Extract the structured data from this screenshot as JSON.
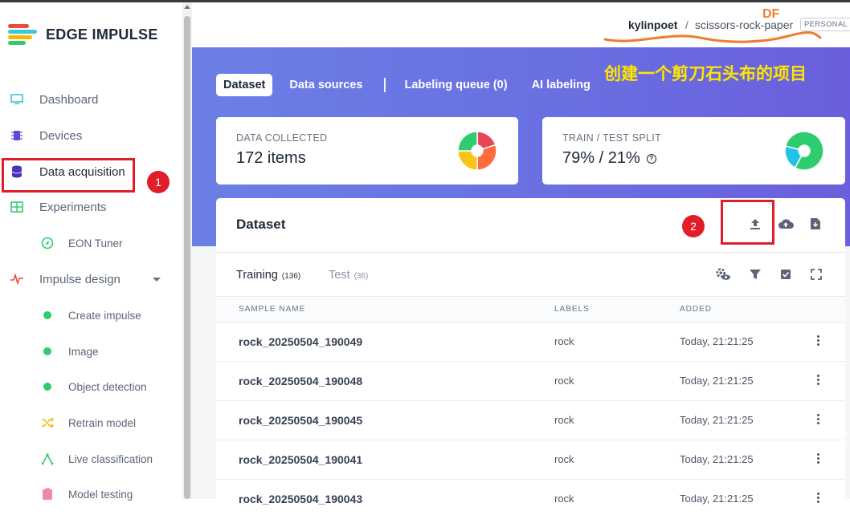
{
  "brand": {
    "name": "EDGE IMPULSE",
    "colors": [
      "#e84c3d",
      "#3ec8d6",
      "#f5b800",
      "#2ecc71"
    ]
  },
  "sidebar": {
    "items": [
      {
        "label": "Dashboard",
        "icon": "monitor-icon"
      },
      {
        "label": "Devices",
        "icon": "chip-icon"
      },
      {
        "label": "Data acquisition",
        "icon": "database-icon",
        "active": true
      },
      {
        "label": "Experiments",
        "icon": "table-icon"
      },
      {
        "label": "EON Tuner",
        "icon": "compass-icon"
      },
      {
        "label": "Impulse design",
        "icon": "pulse-icon"
      },
      {
        "label": "Create impulse",
        "icon": "dot-icon"
      },
      {
        "label": "Image",
        "icon": "dot-icon"
      },
      {
        "label": "Object detection",
        "icon": "dot-icon"
      },
      {
        "label": "Retrain model",
        "icon": "shuffle-icon"
      },
      {
        "label": "Live classification",
        "icon": "signal-icon"
      },
      {
        "label": "Model testing",
        "icon": "clipboard-icon"
      }
    ]
  },
  "annotations": {
    "step1": "1",
    "step2": "2",
    "df": "DF",
    "note": "创建一个剪刀石头布的项目"
  },
  "topbar": {
    "user": "kylinpoet",
    "separator": "/",
    "project": "scissors-rock-paper",
    "plan": "PERSONAL"
  },
  "tabs": [
    "Dataset",
    "Data sources",
    "Labeling queue (0)",
    "AI labeling"
  ],
  "cards": {
    "collected": {
      "label": "DATA COLLECTED",
      "value": "172 items",
      "pie": [
        {
          "color": "#e8445a",
          "fraction": 0.2
        },
        {
          "color": "#ff6b3d",
          "fraction": 0.3
        },
        {
          "color": "#f5c518",
          "fraction": 0.25
        },
        {
          "color": "#2ecc71",
          "fraction": 0.25
        }
      ]
    },
    "split": {
      "label": "TRAIN / TEST SPLIT",
      "value": "79% / 21%",
      "train_fraction": 0.79,
      "train_color": "#2ecc71",
      "test_color": "#22c3e6"
    }
  },
  "dataset": {
    "title": "Dataset",
    "subtabs": [
      {
        "label": "Training",
        "count": "(136)"
      },
      {
        "label": "Test",
        "count": "(36)"
      }
    ],
    "headers": [
      "SAMPLE NAME",
      "LABELS",
      "ADDED"
    ],
    "rows": [
      {
        "name": "rock_20250504_190049",
        "label": "rock",
        "added": "Today, 21:21:25"
      },
      {
        "name": "rock_20250504_190048",
        "label": "rock",
        "added": "Today, 21:21:25"
      },
      {
        "name": "rock_20250504_190045",
        "label": "rock",
        "added": "Today, 21:21:25"
      },
      {
        "name": "rock_20250504_190041",
        "label": "rock",
        "added": "Today, 21:21:25"
      },
      {
        "name": "rock_20250504_190043",
        "label": "rock",
        "added": "Today, 21:21:25"
      }
    ]
  }
}
